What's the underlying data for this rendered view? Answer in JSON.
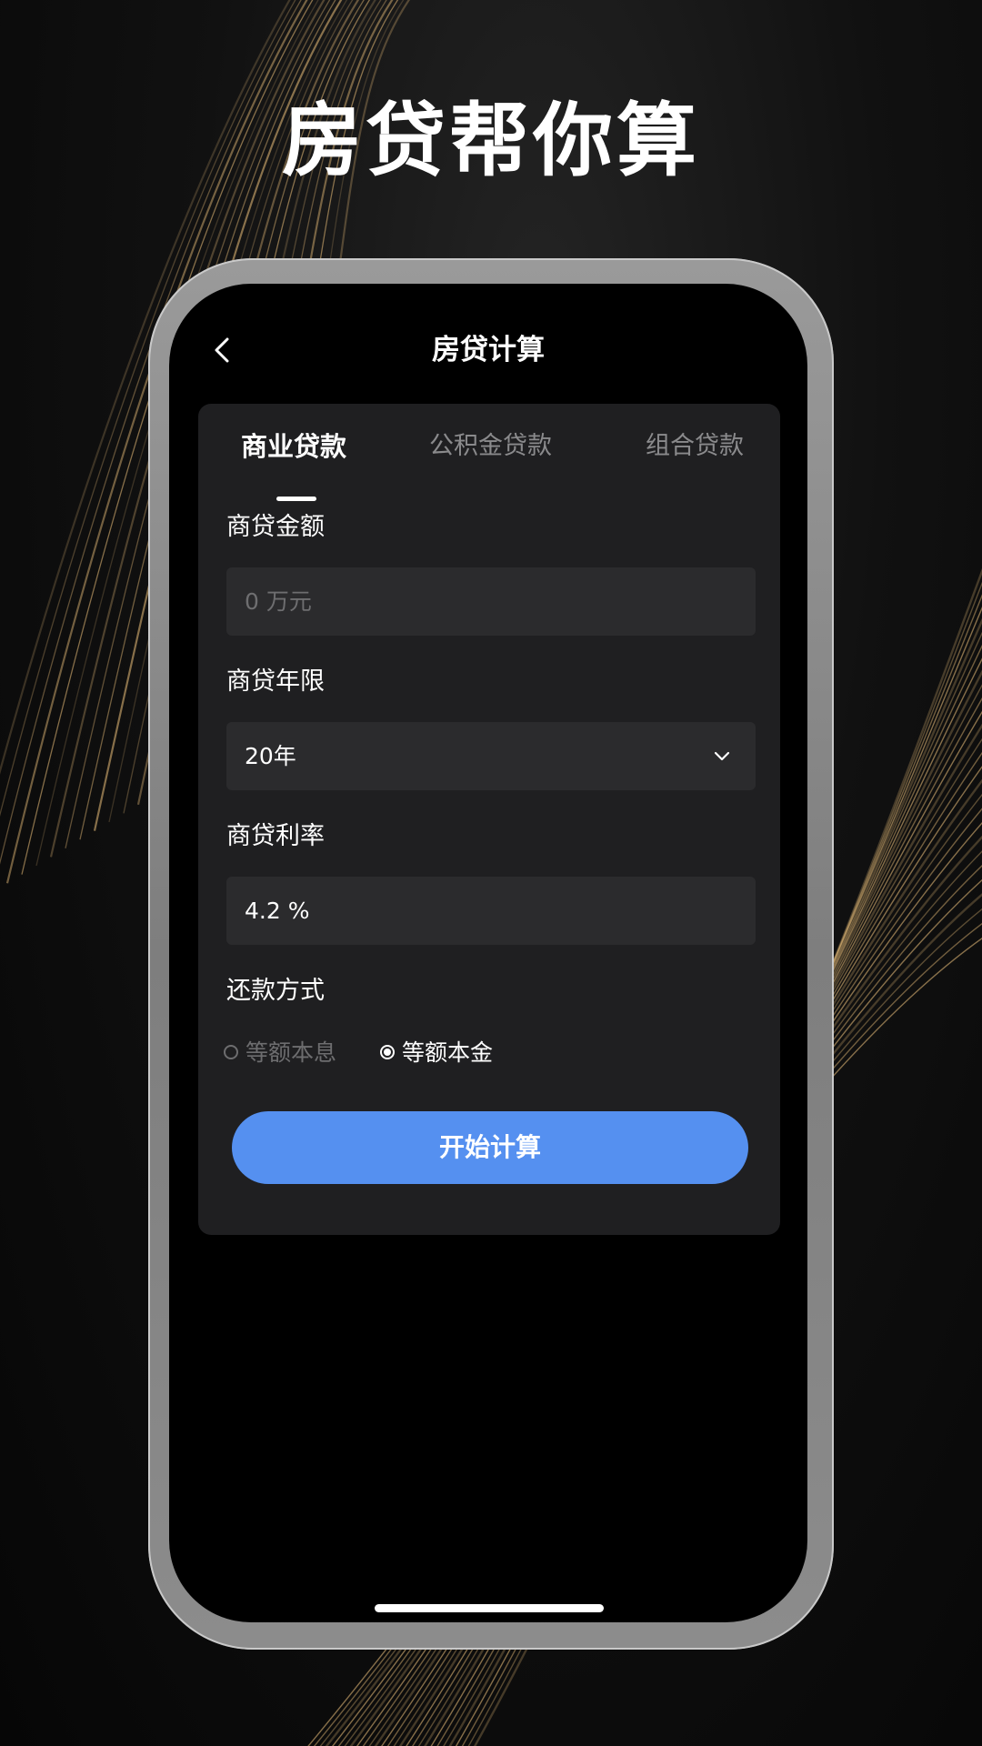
{
  "promo": {
    "headline": "房贷帮你算"
  },
  "header": {
    "title": "房贷计算",
    "back_icon": "chevron-left-icon"
  },
  "tabs": [
    {
      "label": "商业贷款",
      "active": true
    },
    {
      "label": "公积金贷款",
      "active": false
    },
    {
      "label": "组合贷款",
      "active": false
    }
  ],
  "form": {
    "amount": {
      "label": "商贷金额",
      "value": "",
      "placeholder": "0 万元"
    },
    "term": {
      "label": "商贷年限",
      "selected": "20年",
      "icon": "chevron-down-icon"
    },
    "rate": {
      "label": "商贷利率",
      "value": "4.2 %"
    },
    "repayment": {
      "label": "还款方式",
      "options": [
        {
          "label": "等额本息",
          "selected": false
        },
        {
          "label": "等额本金",
          "selected": true
        }
      ]
    }
  },
  "actions": {
    "calculate_label": "开始计算"
  },
  "colors": {
    "accent": "#5590f0",
    "card_bg": "#1f1f21",
    "field_bg": "#2b2b2d",
    "muted_text": "#8a8a8c",
    "line_gold": "#c9a46a"
  }
}
